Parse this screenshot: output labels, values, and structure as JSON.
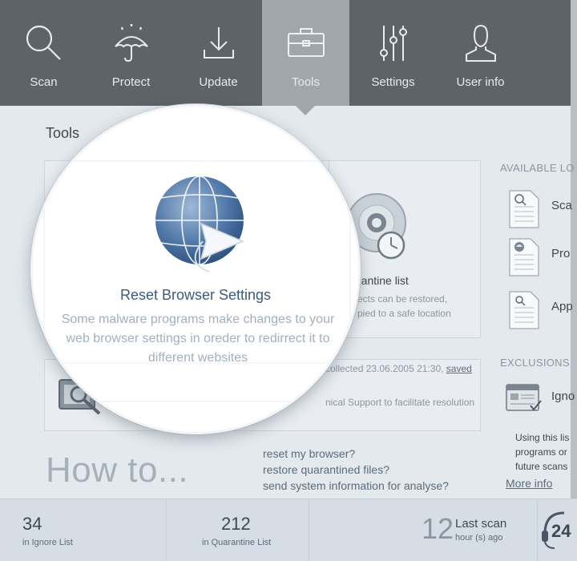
{
  "nav": {
    "items": [
      {
        "label": "Scan",
        "icon": "magnifier-icon"
      },
      {
        "label": "Protect",
        "icon": "umbrella-icon"
      },
      {
        "label": "Update",
        "icon": "download-icon"
      },
      {
        "label": "Tools",
        "icon": "toolbox-icon",
        "active": true
      },
      {
        "label": "Settings",
        "icon": "sliders-icon"
      },
      {
        "label": "User info",
        "icon": "user-icon"
      }
    ]
  },
  "tools": {
    "title": "Tools",
    "reset_browser": {
      "title": "Reset Browser Settings",
      "description": "Some malware programs make changes to your web browser settings in oreder to redirrect it to different websites"
    },
    "quarantine": {
      "title": "rantine list",
      "desc_line1": "ects can be restored,",
      "desc_line2": "pied to a safe location"
    },
    "sysinfo": {
      "line1_prefix": "collected 23.06.2005 21:30, ",
      "line1_link": "saved",
      "line2": "nical Support to facilitate resolution"
    }
  },
  "howto": {
    "title": "How to...",
    "links": [
      "reset my browser?",
      "restore quarantined files?",
      "send system information for analyse?"
    ]
  },
  "sidebar": {
    "logs_header": "AVAILABLE LO",
    "logs": [
      {
        "label": "Sca",
        "icon": "scan-log-icon"
      },
      {
        "label": "Pro",
        "icon": "protect-log-icon"
      },
      {
        "label": "App",
        "icon": "app-log-icon"
      }
    ],
    "exclusions_header": "EXCLUSIONS",
    "exclusion_item": "Igno",
    "exclusion_desc": [
      "Using this lis",
      "programs or",
      "future scans"
    ],
    "more_info": "More info"
  },
  "stats": {
    "ignore": {
      "count": "34",
      "label": "in Ignore List"
    },
    "quarantine": {
      "count": "212",
      "label": "in Quarantine List"
    },
    "last_scan": {
      "value": "12",
      "title": "Last scan",
      "unit": "hour (s) ago"
    },
    "support_label": "24"
  },
  "colors": {
    "nav_bg": "#5d6368",
    "nav_active": "#a0a6ab",
    "page_bg": "#e4e9ee",
    "accent_text": "#3d5a7a",
    "globe_blue": "#4f77a7"
  }
}
